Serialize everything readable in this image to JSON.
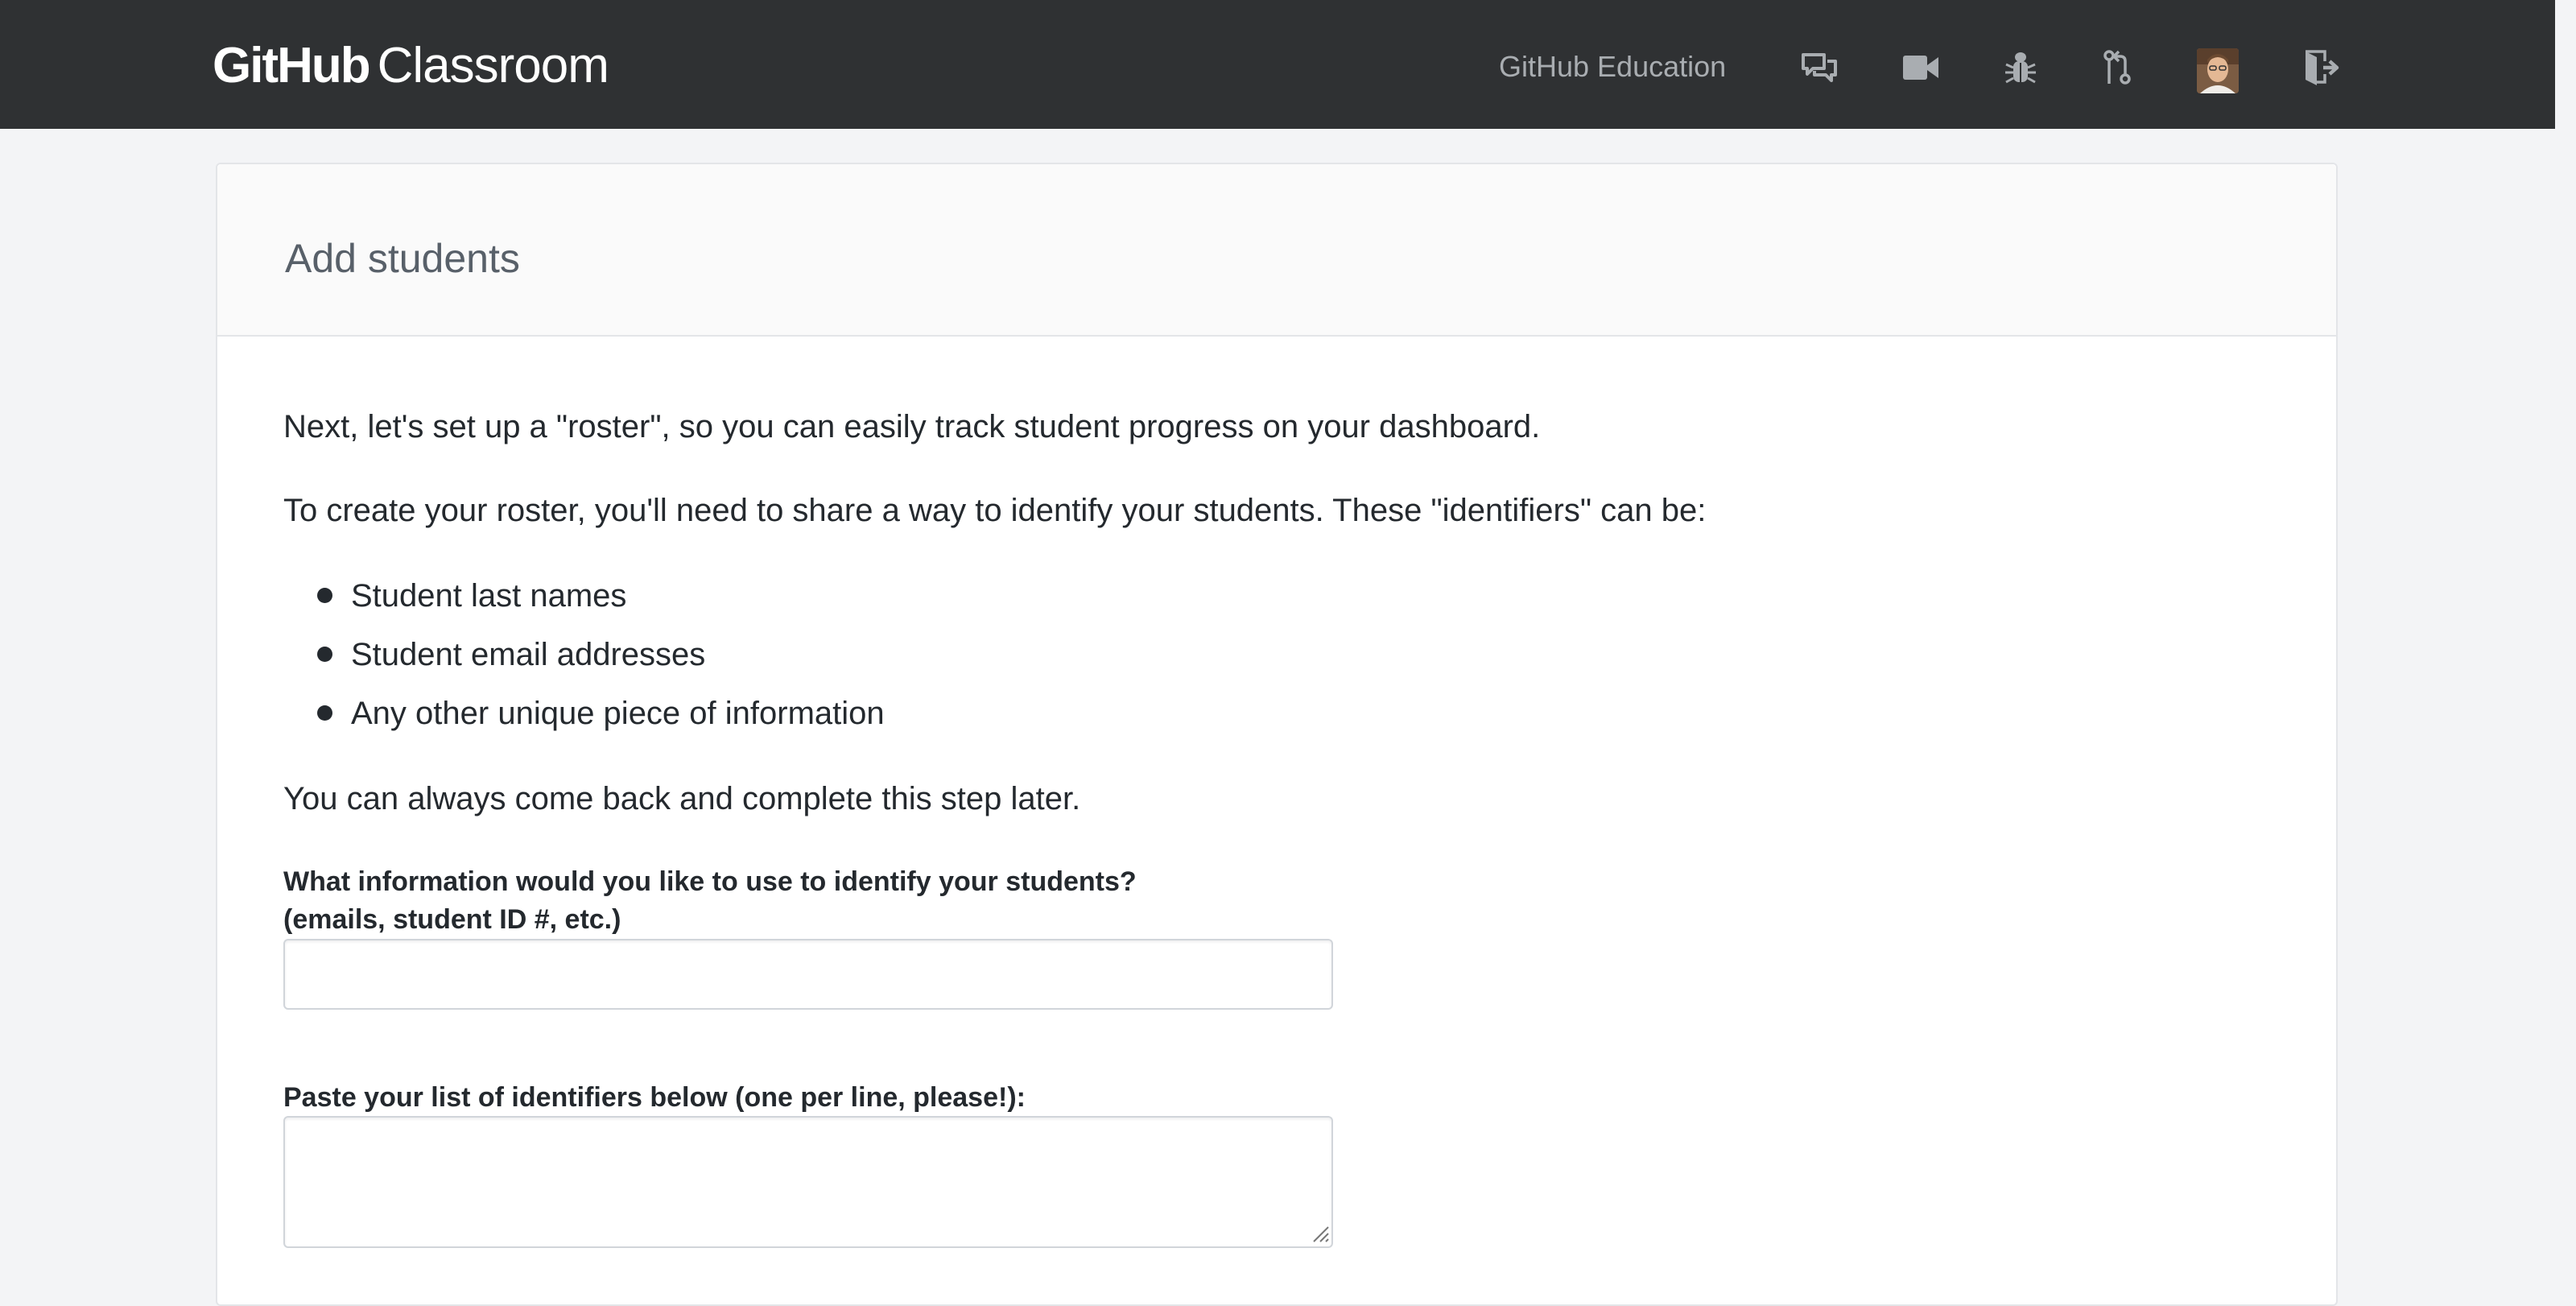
{
  "header": {
    "logo_primary": "GitHub",
    "logo_secondary": "Classroom",
    "nav_link": "GitHub Education",
    "icons": [
      "comment-discussion-icon",
      "video-icon",
      "bug-icon",
      "git-pull-request-icon",
      "avatar",
      "sign-out-icon"
    ]
  },
  "page": {
    "title": "Add students",
    "intro": "Next, let's set up a \"roster\", so you can easily track student progress on your dashboard.",
    "explain": "To create your roster, you'll need to share a way to identify your students. These \"identifiers\" can be:",
    "identifiers": [
      "Student last names",
      "Student email addresses",
      "Any other unique piece of information"
    ],
    "later_note": "You can always come back and complete this step later."
  },
  "form": {
    "identifier_label_line1": "What information would you like to use to identify your students?",
    "identifier_label_line2": "(emails, student ID #, etc.)",
    "identifier_value": "",
    "list_label": "Paste your list of identifiers below (one per line, please!):",
    "list_value": ""
  },
  "colors": {
    "topbar": "#2f3133",
    "page_background": "#f3f4f6",
    "nav_text": "#a9adb1",
    "title_text": "#586069",
    "body_text": "#24292e"
  }
}
